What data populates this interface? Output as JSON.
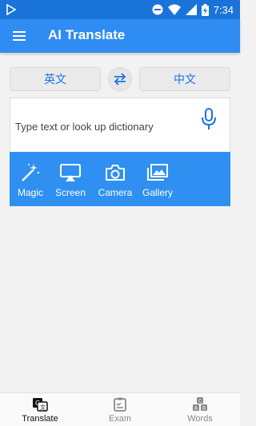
{
  "status_bar": {
    "time": "7:34",
    "icons": [
      "play-store-icon",
      "do-not-disturb-icon",
      "wifi-icon",
      "signal-icon",
      "battery-icon"
    ]
  },
  "app_bar": {
    "title": "AI Translate",
    "menu_icon": "menu-icon"
  },
  "languages": {
    "source": "英文",
    "target": "中文",
    "swap_icon": "swap-icon"
  },
  "input": {
    "placeholder": "Type text or look up dictionary",
    "mic_icon": "microphone-icon"
  },
  "tools": [
    {
      "label": "Magic",
      "icon": "magic-wand-icon"
    },
    {
      "label": "Screen",
      "icon": "screen-cast-icon"
    },
    {
      "label": "Camera",
      "icon": "camera-icon"
    },
    {
      "label": "Gallery",
      "icon": "gallery-icon"
    }
  ],
  "bottom_nav": [
    {
      "label": "Translate",
      "icon": "translate-icon",
      "active": true
    },
    {
      "label": "Exam",
      "icon": "exam-icon",
      "active": false
    },
    {
      "label": "Words",
      "icon": "words-icon",
      "active": false
    }
  ],
  "colors": {
    "status_bar": "#1a73d9",
    "app_bar": "#2e8cf2",
    "tools_bar": "#2f90f2",
    "accent": "#1a73e8",
    "background": "#f2f2f2"
  }
}
